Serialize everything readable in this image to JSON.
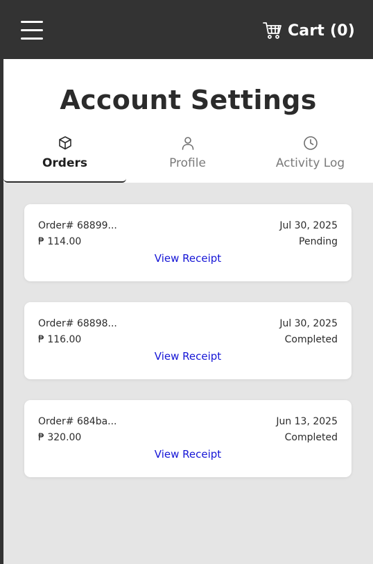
{
  "header": {
    "menu_icon": "hamburger-menu-icon",
    "cart_icon": "shopping-cart-icon",
    "cart_label": "Cart (0)"
  },
  "page": {
    "title": "Account Settings"
  },
  "tabs": [
    {
      "label": "Orders",
      "icon": "box-icon",
      "active": true
    },
    {
      "label": "Profile",
      "icon": "user-icon",
      "active": false
    },
    {
      "label": "Activity Log",
      "icon": "clock-icon",
      "active": false
    }
  ],
  "orders": [
    {
      "id": "Order# 68899...",
      "price": "₱ 114.00",
      "date": "Jul 30, 2025",
      "status": "Pending",
      "action": "View Receipt"
    },
    {
      "id": "Order# 68898...",
      "price": "₱ 116.00",
      "date": "Jul 30, 2025",
      "status": "Completed",
      "action": "View Receipt"
    },
    {
      "id": "Order# 684ba...",
      "price": "₱ 320.00",
      "date": "Jun 13, 2025",
      "status": "Completed",
      "action": "View Receipt"
    }
  ],
  "colors": {
    "topbar": "#333333",
    "background": "#e5e5e5",
    "link": "#1515d6",
    "text": "#2b2b2b",
    "muted": "#7a7a7a"
  }
}
